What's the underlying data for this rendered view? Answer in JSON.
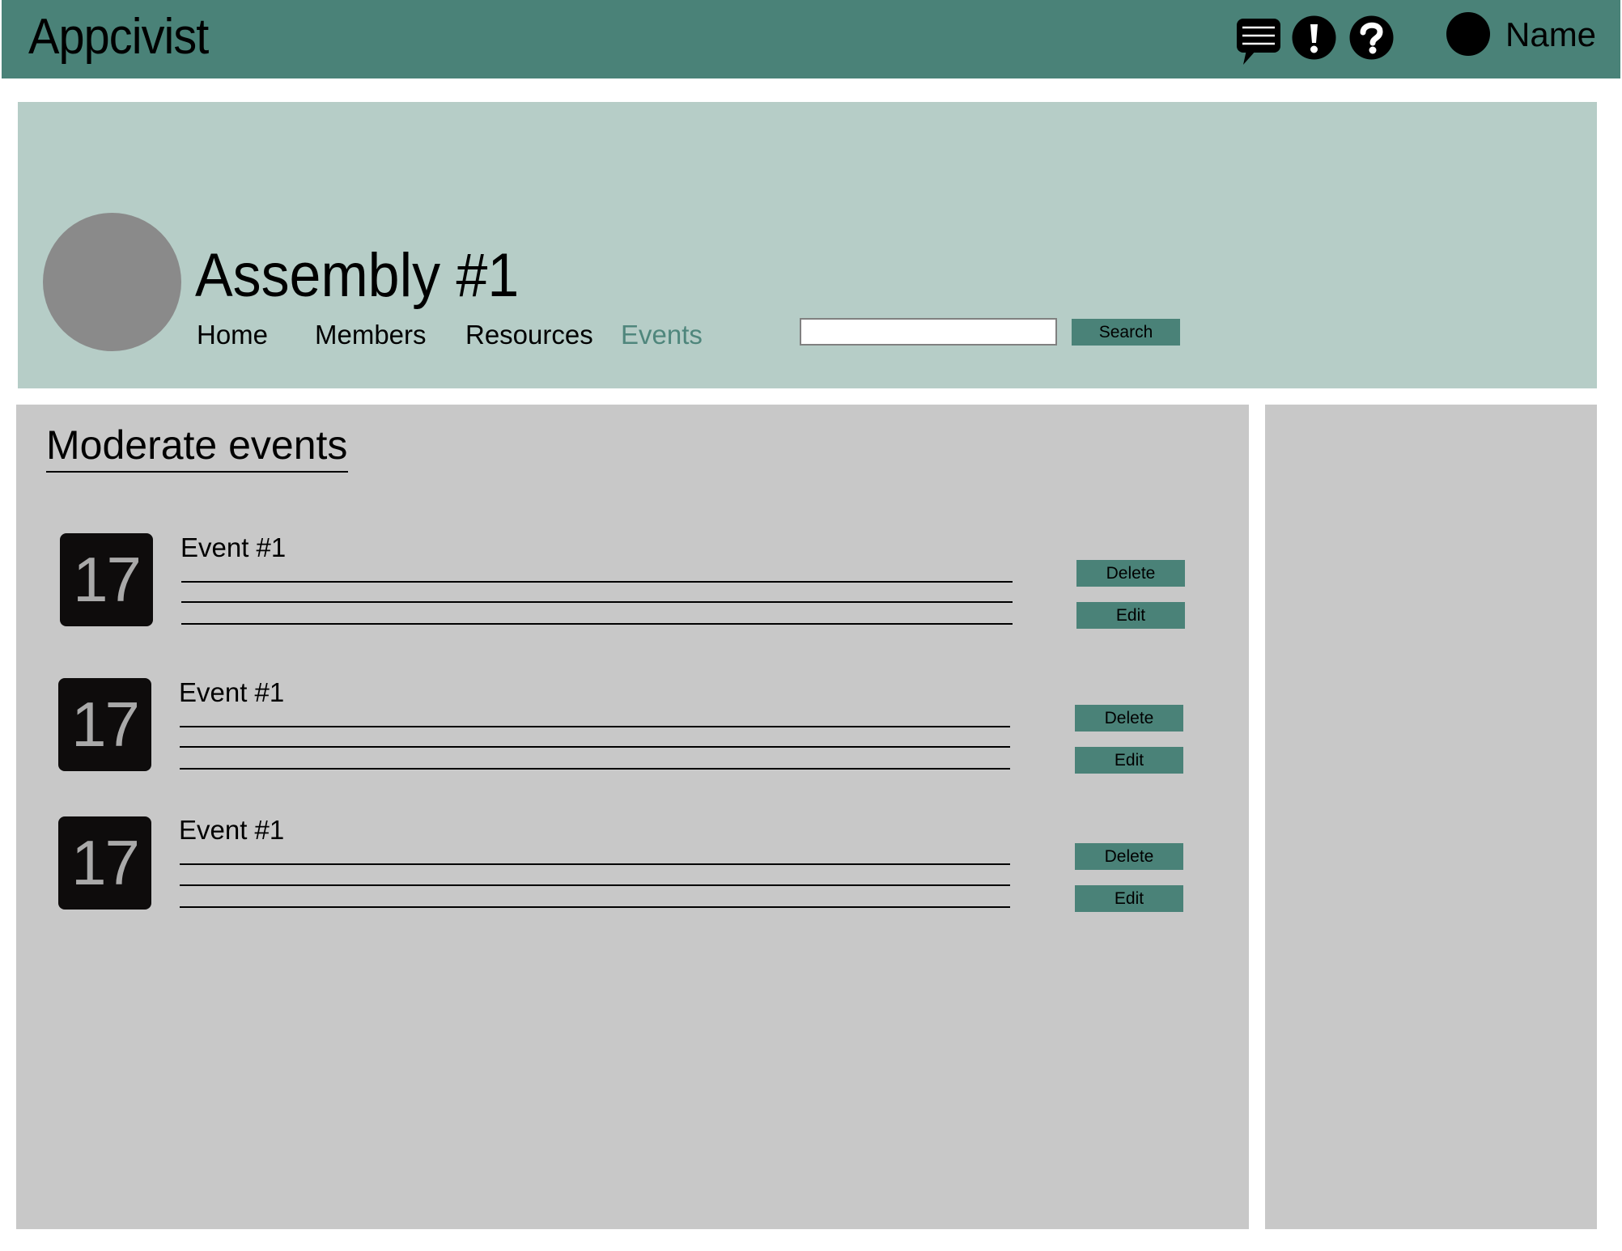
{
  "header": {
    "brand": "Appcivist",
    "icons": [
      "chat-icon",
      "alert-icon",
      "help-icon"
    ],
    "user_name": "Name"
  },
  "banner": {
    "title": "Assembly #1",
    "nav": [
      {
        "label": "Home",
        "active": false
      },
      {
        "label": "Members",
        "active": false
      },
      {
        "label": "Resources",
        "active": false
      },
      {
        "label": "Events",
        "active": true
      }
    ],
    "search": {
      "value": "",
      "placeholder": "",
      "button_label": "Search"
    }
  },
  "main": {
    "section_title": "Moderate events",
    "events": [
      {
        "day": "17",
        "title": "Event #1",
        "delete_label": "Delete",
        "edit_label": "Edit"
      },
      {
        "day": "17",
        "title": "Event #1",
        "delete_label": "Delete",
        "edit_label": "Edit"
      },
      {
        "day": "17",
        "title": "Event #1",
        "delete_label": "Delete",
        "edit_label": "Edit"
      }
    ]
  },
  "colors": {
    "primary": "#4a8278",
    "banner_bg": "#b6cdc7",
    "panel_bg": "#c8c8c8",
    "active_nav": "#4f867c",
    "avatar_gray": "#8a8a8a"
  }
}
